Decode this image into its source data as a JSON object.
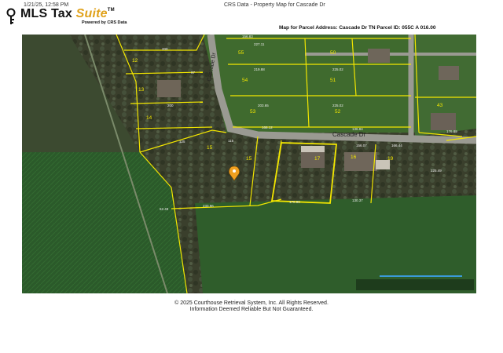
{
  "header": {
    "datetime": "1/21/25, 12:58 PM",
    "page_title": "CRS Data - Property Map for Cascade Dr"
  },
  "logo": {
    "name_part1": "MLS Tax ",
    "name_part2": "Suite",
    "trademark": "TM",
    "powered_by": "Powered by CRS Data"
  },
  "map_header": {
    "label": "Map for Parcel Address:",
    "address": "Cascade Dr TN",
    "parcel_label": "Parcel ID:",
    "parcel_id": "055C A 016.00"
  },
  "map": {
    "street_names": [
      "Cascade Dr",
      "Cascade Dr"
    ],
    "lot_numbers": [
      "12",
      "13",
      "14",
      "15",
      "16",
      "17",
      "18",
      "19",
      "43",
      "50",
      "51",
      "52",
      "53",
      "54",
      "55"
    ],
    "dimension_labels": [
      "156.83",
      "227.11",
      "219.88",
      "225.02",
      "203.65",
      "225.02",
      "168.12",
      "136.84",
      "156.07",
      "166.44",
      "225.49",
      "115",
      "233.96",
      "170.90",
      "130.37",
      "62.49",
      "176.89",
      "200",
      "200",
      "125",
      "97"
    ],
    "pin_color": "#f0a020",
    "parcel_line_color": "#f2e600"
  },
  "footer": {
    "copyright": "© 2025 Courthouse Retrieval System, Inc. All Rights Reserved.",
    "disclaimer": "Information Deemed Reliable But Not Guaranteed."
  }
}
